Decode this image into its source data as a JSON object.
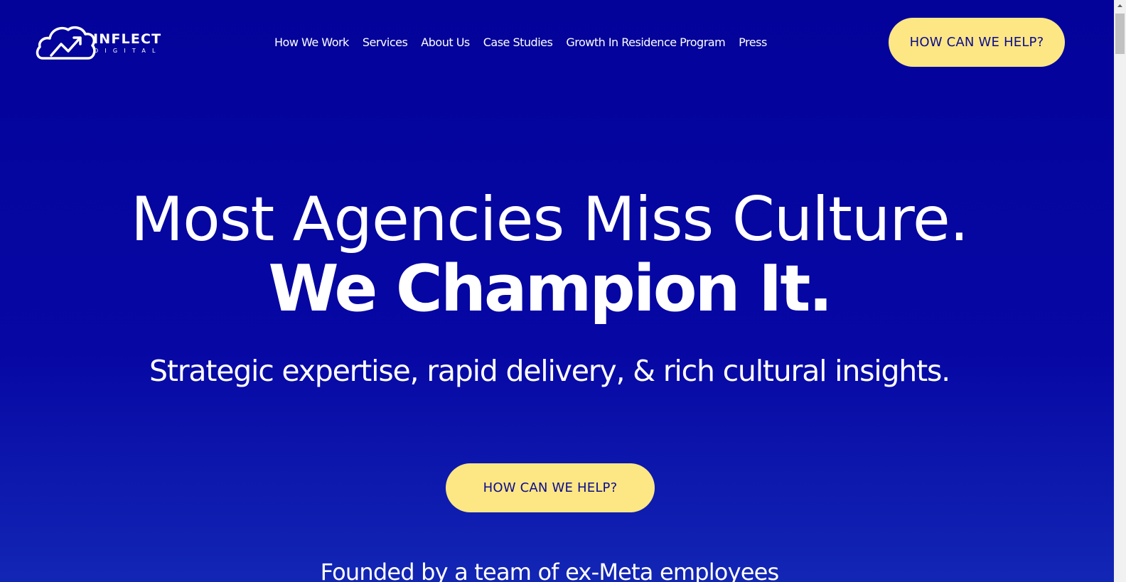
{
  "brand": {
    "name": "INFLECT",
    "sub": "DIGITAL"
  },
  "nav": {
    "items": [
      {
        "label": "How We Work"
      },
      {
        "label": "Services"
      },
      {
        "label": "About Us"
      },
      {
        "label": "Case Studies"
      },
      {
        "label": "Growth In Residence Program"
      },
      {
        "label": "Press"
      }
    ]
  },
  "header": {
    "cta_label": "HOW CAN WE HELP?"
  },
  "hero": {
    "line1": "Most Agencies Miss Culture.",
    "line2": "We Champion It.",
    "tagline": "Strategic expertise, rapid delivery, & rich cultural insights.",
    "cta_label": "HOW CAN WE HELP?",
    "founded": "Founded by a team of ex-Meta employees"
  },
  "colors": {
    "background": "#0707a4",
    "cta_background": "#fde784",
    "cta_text": "#0b0b8f"
  },
  "icons": {
    "logo": "cloud-growth-arrow-icon",
    "scroll_up": "triangle-up-icon"
  }
}
